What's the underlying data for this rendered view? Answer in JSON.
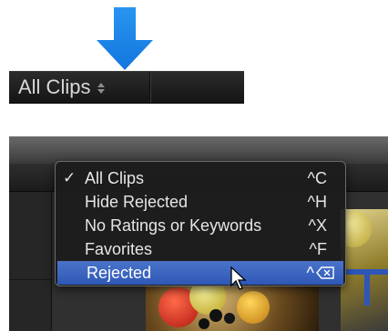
{
  "filter_bar": {
    "selected_label": "All Clips",
    "icons": {
      "popup": "up-down-chevron-icon",
      "annotation": "down-arrow-icon"
    }
  },
  "menu": {
    "items": [
      {
        "label": "All Clips",
        "shortcut": "^C",
        "checked": true,
        "highlighted": false
      },
      {
        "label": "Hide Rejected",
        "shortcut": "^H",
        "checked": false,
        "highlighted": false
      },
      {
        "label": "No Ratings or Keywords",
        "shortcut": "^X",
        "checked": false,
        "highlighted": false
      },
      {
        "label": "Favorites",
        "shortcut": "^F",
        "checked": false,
        "highlighted": false
      },
      {
        "label": "Rejected",
        "shortcut": "^",
        "shortcut_icon": "delete-key-icon",
        "checked": false,
        "highlighted": true
      }
    ],
    "checkmark": "✓"
  },
  "colors": {
    "annotation_arrow": "#1a86e8",
    "menu_highlight": "#3561bd",
    "bar_background": "#1e1e1e"
  }
}
